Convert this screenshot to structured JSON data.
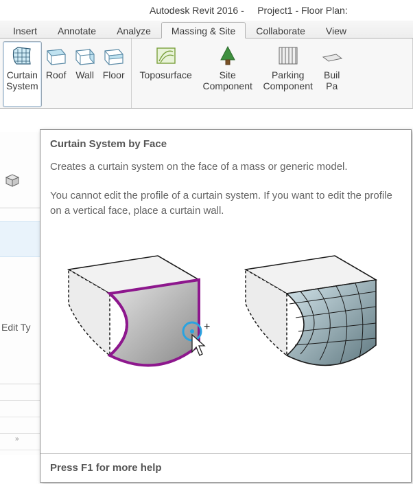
{
  "title": "Autodesk Revit 2016 -     Project1 - Floor Plan:",
  "tabs": [
    {
      "label": "Insert",
      "active": false
    },
    {
      "label": "Annotate",
      "active": false
    },
    {
      "label": "Analyze",
      "active": false
    },
    {
      "label": "Massing & Site",
      "active": true
    },
    {
      "label": "Collaborate",
      "active": false
    },
    {
      "label": "View",
      "active": false
    }
  ],
  "ribbon": {
    "panel_modelbyface": {
      "curtain_system": "Curtain\nSystem",
      "roof": "Roof",
      "wall": "Wall",
      "floor": "Floor"
    },
    "panel_site": {
      "toposurface": "Toposurface",
      "site_component": "Site\nComponent",
      "parking_component": "Parking\nComponent",
      "building_pad": "Buil\nPa"
    }
  },
  "properties_panel": {
    "edit_type_label": "Edit Ty",
    "collapse_glyph": "»"
  },
  "tooltip": {
    "title": "Curtain System by Face",
    "desc1": "Creates a curtain system on the face of a mass or generic model.",
    "desc2": "You cannot edit the profile of a curtain system. If you want to edit the profile on a vertical face, place a curtain wall.",
    "footer": "Press F1 for more help"
  }
}
